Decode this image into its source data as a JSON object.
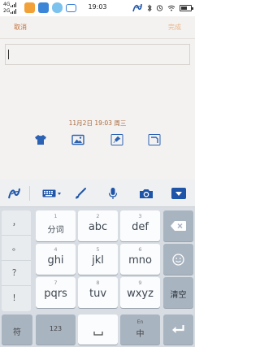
{
  "status_bar": {
    "signal_top": "4G",
    "signal_bottom": "2G",
    "time": "19:03",
    "icons": [
      "app-orange-icon",
      "app-blue-icon",
      "app-sky-icon",
      "camera-app-icon",
      "pen-logo-icon",
      "bluetooth-icon",
      "alarm-icon",
      "wifi-icon",
      "battery-icon"
    ]
  },
  "title_bar": {
    "cancel_label": "取消",
    "done_label": "完成"
  },
  "editor": {
    "input_value": "",
    "timestamp": "11月2日 19:03 周三",
    "tools": [
      "shirt-icon",
      "image-icon",
      "pin-icon",
      "corner-icon"
    ]
  },
  "keyboard": {
    "toolbar_icons": [
      "pen-logo-icon",
      "keyboard-icon",
      "brush-icon",
      "mic-icon",
      "camera-icon",
      "collapse-icon"
    ],
    "punct_keys": [
      "，",
      "。",
      "？",
      "！"
    ],
    "keys": {
      "k1": {
        "num": "1",
        "label": "分词"
      },
      "k2": {
        "num": "2",
        "label": "abc"
      },
      "k3": {
        "num": "3",
        "label": "def"
      },
      "k4": {
        "num": "4",
        "label": "ghi"
      },
      "k5": {
        "num": "5",
        "label": "jkl"
      },
      "k6": {
        "num": "6",
        "label": "mno"
      },
      "k7": {
        "num": "7",
        "label": "pqrs"
      },
      "k8": {
        "num": "8",
        "label": "tuv"
      },
      "k9": {
        "num": "9",
        "label": "wxyz"
      }
    },
    "clear_label": "清空",
    "symbol_label": "符",
    "num_label": "123",
    "lang_small": "En",
    "lang_main": "中",
    "colors": {
      "accent": "#1f55a8",
      "dark_key": "#a9b4c1",
      "light_key": "#fbfcfd"
    }
  }
}
